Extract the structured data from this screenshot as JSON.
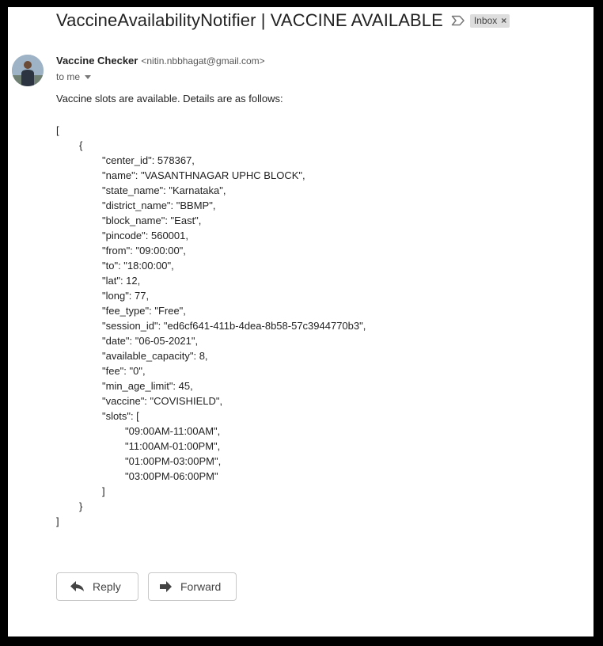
{
  "email": {
    "subject": "VaccineAvailabilityNotifier | VACCINE AVAILABLE",
    "label": "Inbox",
    "sender_name": "Vaccine Checker",
    "sender_email": "<nitin.nbbhagat@gmail.com>",
    "recipient": "to me",
    "intro": "Vaccine slots are available. Details are as follows:",
    "body_lines": [
      "[",
      "{",
      "\"center_id\": 578367,",
      "\"name\": \"VASANTHNAGAR UPHC BLOCK\",",
      "\"state_name\": \"Karnataka\",",
      "\"district_name\": \"BBMP\",",
      "\"block_name\": \"East\",",
      "\"pincode\": 560001,",
      "\"from\": \"09:00:00\",",
      "\"to\": \"18:00:00\",",
      "\"lat\": 12,",
      "\"long\": 77,",
      "\"fee_type\": \"Free\",",
      "\"session_id\": \"ed6cf641-411b-4dea-8b58-57c3944770b3\",",
      "\"date\": \"06-05-2021\",",
      "\"available_capacity\": 8,",
      "\"fee\": \"0\",",
      "\"min_age_limit\": 45,",
      "\"vaccine\": \"COVISHIELD\",",
      "\"slots\": [",
      "\"09:00AM-11:00AM\",",
      "\"11:00AM-01:00PM\",",
      "\"01:00PM-03:00PM\",",
      "\"03:00PM-06:00PM\"",
      "]",
      "}",
      "]"
    ]
  },
  "actions": {
    "reply_label": "Reply",
    "forward_label": "Forward"
  },
  "icons": {
    "important": "important-marker-icon",
    "label_remove": "close-icon",
    "recipient_details": "chevron-down-icon",
    "reply": "reply-arrow-icon",
    "forward": "forward-arrow-icon"
  }
}
